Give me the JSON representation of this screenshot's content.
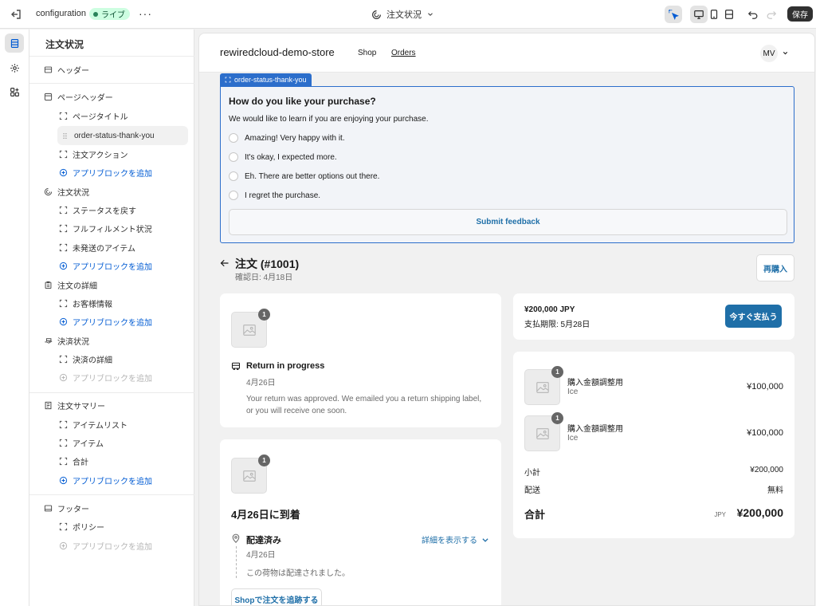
{
  "topbar": {
    "title": "configuration",
    "status": "ライブ",
    "page_name": "注文状況",
    "save": "保存"
  },
  "sidebar": {
    "title": "注文状況",
    "items": {
      "header": "ヘッダー",
      "page_header": "ページヘッダー",
      "page_title": "ページタイトル",
      "order_status_thank_you": "order-status-thank-you",
      "order_actions": "注文アクション",
      "add_app_block": "アプリブロックを追加",
      "order_status": "注文状況",
      "return_status": "ステータスを戻す",
      "fulfillment_status": "フルフィルメント状況",
      "unfulfilled_items": "未発送のアイテム",
      "order_details": "注文の詳細",
      "customer_info": "お客様情報",
      "payment_status": "決済状況",
      "payment_details": "決済の詳細",
      "order_summary": "注文サマリー",
      "item_list": "アイテムリスト",
      "item": "アイテム",
      "total": "合計",
      "footer": "フッター",
      "policy": "ポリシー"
    }
  },
  "preview": {
    "store_name": "rewiredcloud-demo-store",
    "nav": {
      "shop": "Shop",
      "orders": "Orders"
    },
    "avatar": "MV",
    "block_tag": "order-status-thank-you",
    "survey": {
      "question": "How do you like your purchase?",
      "subtitle": "We would like to learn if you are enjoying your purchase.",
      "options": [
        "Amazing! Very happy with it.",
        "It's okay, I expected more.",
        "Eh. There are better options out there.",
        "I regret the purchase."
      ],
      "submit": "Submit feedback"
    },
    "order": {
      "title": "注文 (#1001)",
      "confirmed": "確認日: 4月18日",
      "reorder": "再購入"
    },
    "return_card": {
      "qty": "1",
      "title": "Return in progress",
      "date": "4月26日",
      "description": "Your return was approved. We emailed you a return shipping label, or you will receive one soon."
    },
    "delivery_card": {
      "qty": "1",
      "arrival": "4月26日に到着",
      "status": "配達済み",
      "date": "4月26日",
      "details_link": "詳細を表示する",
      "description": "この荷物は配達されました。",
      "track_button": "Shopで注文を追跡する"
    },
    "payment": {
      "amount": "¥200,000 JPY",
      "due": "支払期限: 5月28日",
      "pay_now": "今すぐ支払う"
    },
    "summary": {
      "items": [
        {
          "qty": "1",
          "name": "購入金額調整用",
          "variant": "Ice",
          "price": "¥100,000"
        },
        {
          "qty": "1",
          "name": "購入金額調整用",
          "variant": "Ice",
          "price": "¥100,000"
        }
      ],
      "subtotal_label": "小計",
      "subtotal": "¥200,000",
      "shipping_label": "配送",
      "shipping": "無料",
      "total_label": "合計",
      "currency": "JPY",
      "total": "¥200,000"
    }
  },
  "colors": {
    "accent_blue": "#2c6ecb",
    "button_blue": "#1f6fa8",
    "live_badge": "#cdfee1",
    "save_button": "#303030"
  }
}
